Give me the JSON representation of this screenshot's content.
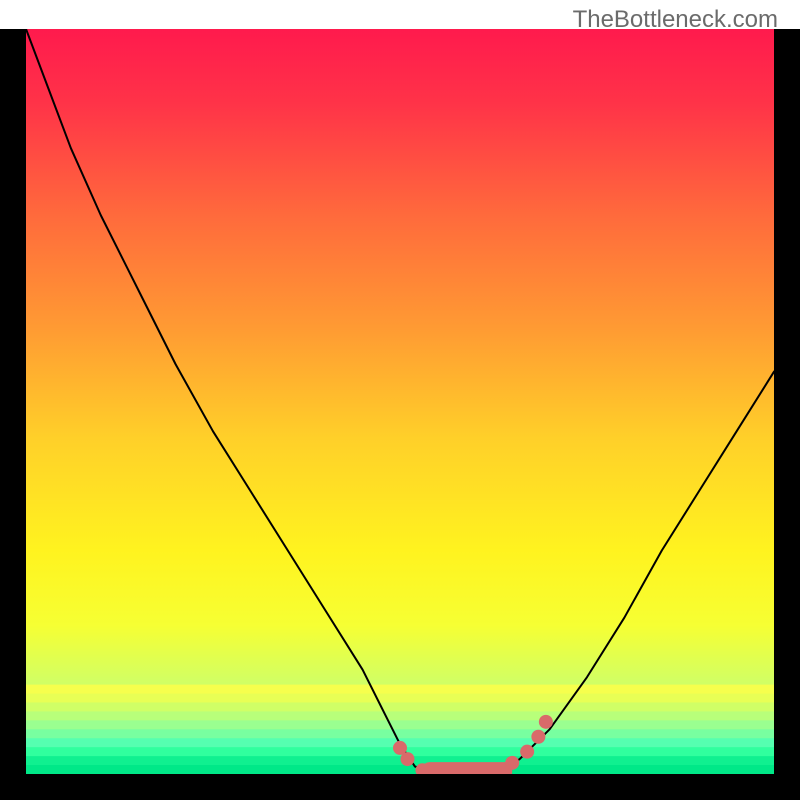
{
  "watermark": "TheBottleneck.com",
  "chart_data": {
    "type": "line",
    "title": "",
    "xlabel": "",
    "ylabel": "",
    "xlim": [
      0,
      100
    ],
    "ylim": [
      0,
      100
    ],
    "background_gradient": {
      "stops": [
        {
          "offset": 0.0,
          "color": "#ff1a4d"
        },
        {
          "offset": 0.1,
          "color": "#ff3348"
        },
        {
          "offset": 0.25,
          "color": "#ff6a3c"
        },
        {
          "offset": 0.4,
          "color": "#ff9a33"
        },
        {
          "offset": 0.55,
          "color": "#ffd029"
        },
        {
          "offset": 0.7,
          "color": "#fff31f"
        },
        {
          "offset": 0.8,
          "color": "#f6ff33"
        },
        {
          "offset": 0.88,
          "color": "#d0ff66"
        },
        {
          "offset": 0.94,
          "color": "#8affaa"
        },
        {
          "offset": 0.97,
          "color": "#2eff9f"
        },
        {
          "offset": 1.0,
          "color": "#00e88c"
        }
      ],
      "bottom_stripes": [
        "#f6ff4d",
        "#e8ff55",
        "#d0ff66",
        "#b8ff7a",
        "#9aff90",
        "#78ffa0",
        "#55ffb0",
        "#30ff9e",
        "#10f090",
        "#00e888"
      ]
    },
    "series": [
      {
        "name": "bottleneck-curve",
        "color": "#000000",
        "width": 2,
        "x": [
          0,
          3,
          6,
          10,
          15,
          20,
          25,
          30,
          35,
          40,
          45,
          48,
          50,
          52,
          55,
          60,
          63,
          66,
          70,
          75,
          80,
          85,
          90,
          95,
          100,
          102
        ],
        "y": [
          100,
          92,
          84,
          75,
          65,
          55,
          46,
          38,
          30,
          22,
          14,
          8,
          4,
          1,
          0,
          0,
          0,
          2,
          6,
          13,
          21,
          30,
          38,
          46,
          54,
          56
        ]
      }
    ],
    "markers": {
      "name": "highlight-dots",
      "color": "#d96a6a",
      "radius": 7,
      "points": [
        {
          "x": 50,
          "y": 3.5
        },
        {
          "x": 51,
          "y": 2
        },
        {
          "x": 53,
          "y": 0.5
        },
        {
          "x": 55,
          "y": 0
        },
        {
          "x": 57,
          "y": 0
        },
        {
          "x": 59,
          "y": 0
        },
        {
          "x": 61,
          "y": 0
        },
        {
          "x": 63,
          "y": 0.5
        },
        {
          "x": 65,
          "y": 1.5
        },
        {
          "x": 67,
          "y": 3
        },
        {
          "x": 68.5,
          "y": 5
        },
        {
          "x": 69.5,
          "y": 7
        }
      ]
    },
    "horizontal_bar": {
      "color": "#d96a6a",
      "x_start": 53,
      "x_end": 65,
      "y": 0,
      "thickness": 1.6
    }
  }
}
